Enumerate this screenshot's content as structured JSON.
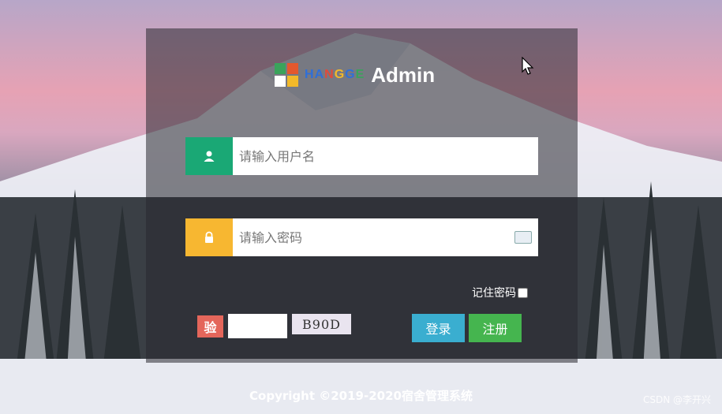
{
  "logo": {
    "squares": [
      "#3aa35b",
      "#e4582e",
      "#ffffff",
      "#f2b92a"
    ],
    "brand_letters": [
      {
        "ch": "H",
        "color": "#2f6fd8"
      },
      {
        "ch": "A",
        "color": "#2f6fd8"
      },
      {
        "ch": "N",
        "color": "#e24a3a"
      },
      {
        "ch": "G",
        "color": "#f2b92a"
      },
      {
        "ch": "G",
        "color": "#2f6fd8"
      },
      {
        "ch": "E",
        "color": "#3aa35b"
      }
    ],
    "title": "Admin"
  },
  "username": {
    "placeholder": "请输入用户名",
    "icon": "user-icon",
    "icon_color": "#1aa875"
  },
  "password": {
    "placeholder": "请输入密码",
    "icon": "lock-icon",
    "icon_color": "#f7b731"
  },
  "remember": {
    "label": "记住密码"
  },
  "captcha": {
    "badge": "验",
    "code": "B90D"
  },
  "buttons": {
    "login": "登录",
    "register": "注册"
  },
  "footer": {
    "copyright": "Copyright ©2019-2020宿舍管理系统"
  },
  "watermark": "CSDN @李开兴"
}
